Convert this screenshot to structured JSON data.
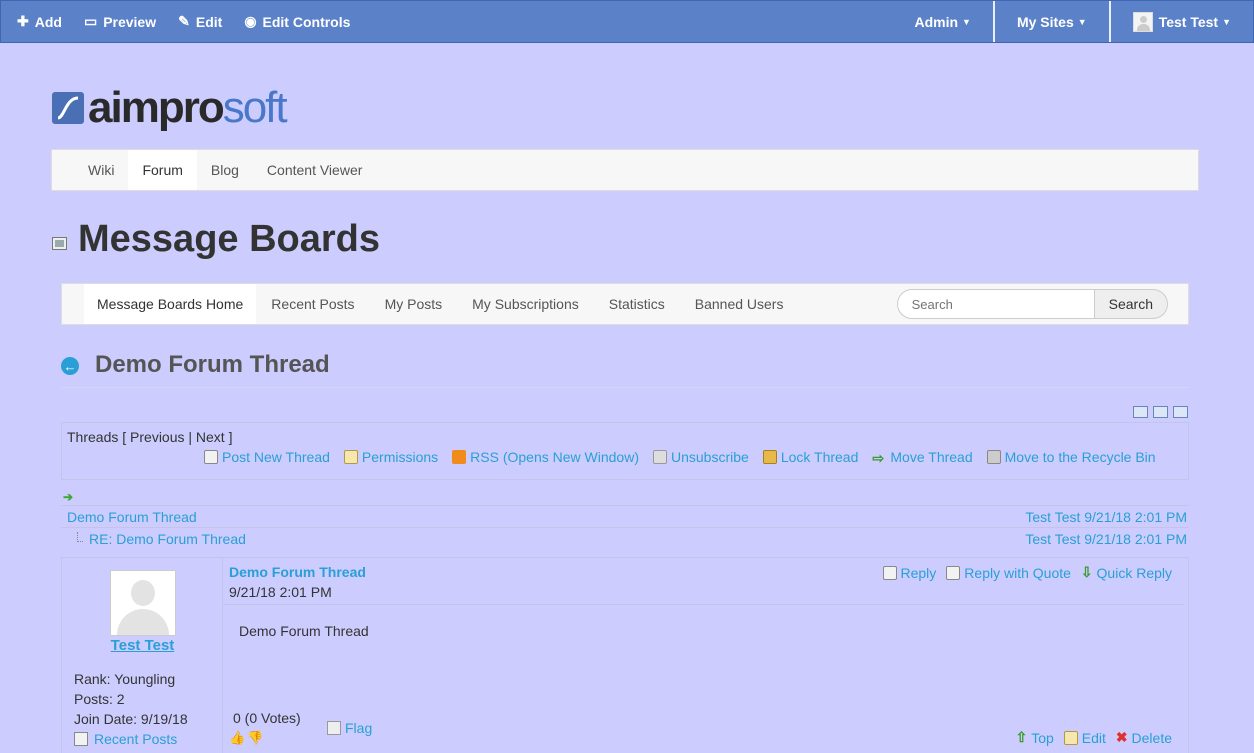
{
  "dockbar": {
    "add": "Add",
    "preview": "Preview",
    "edit": "Edit",
    "edit_controls": "Edit Controls",
    "admin": "Admin",
    "my_sites": "My Sites",
    "user": "Test Test"
  },
  "logo": {
    "part1": "aimpro",
    "part2": "soft"
  },
  "mainnav": [
    "Wiki",
    "Forum",
    "Blog",
    "Content Viewer"
  ],
  "portlet": {
    "title": "Message Boards"
  },
  "mbnav": {
    "items": [
      "Message Boards Home",
      "Recent Posts",
      "My Posts",
      "My Subscriptions",
      "Statistics",
      "Banned Users"
    ],
    "search_placeholder": "Search",
    "search_button": "Search"
  },
  "thread": {
    "title": "Demo Forum Thread",
    "nav_text": "Threads [ Previous | Next ]",
    "actions": [
      "Post New Thread",
      "Permissions",
      "RSS (Opens New Window)",
      "Unsubscribe",
      "Lock Thread",
      "Move Thread",
      "Move to the Recycle Bin"
    ],
    "tree": [
      {
        "title": "Demo Forum Thread",
        "meta": "Test Test 9/21/18 2:01 PM"
      },
      {
        "title": "RE: Demo Forum Thread",
        "meta": "Test Test 9/21/18 2:01 PM"
      }
    ]
  },
  "message": {
    "username": "Test Test",
    "rank": "Rank: Youngling",
    "posts": "Posts: 2",
    "join_date": "Join Date: 9/19/18",
    "recent_posts": "Recent Posts",
    "subject": "Demo Forum Thread",
    "date": "9/21/18 2:01 PM",
    "body": "Demo Forum Thread",
    "reply": "Reply",
    "reply_quote": "Reply with Quote",
    "quick_reply": "Quick Reply",
    "votes": "0 (0 Votes)",
    "flag": "Flag",
    "top": "Top",
    "edit": "Edit",
    "delete": "Delete"
  }
}
